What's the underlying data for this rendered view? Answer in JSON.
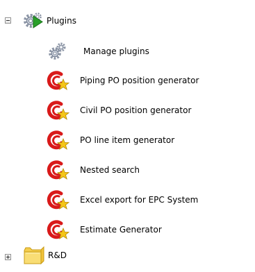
{
  "tree": {
    "root": {
      "label": "Plugins",
      "icon": "plugins-gears-play-icon",
      "expanded": true,
      "children": [
        {
          "label": "Manage plugins",
          "icon": "gears-icon"
        },
        {
          "label": "Piping PO position generator",
          "icon": "plugin-star-icon"
        },
        {
          "label": "Civil PO position generator",
          "icon": "plugin-star-icon"
        },
        {
          "label": "PO line item generator",
          "icon": "plugin-star-icon"
        },
        {
          "label": "Nested search",
          "icon": "plugin-star-icon"
        },
        {
          "label": "Excel export for EPC System",
          "icon": "plugin-star-icon"
        },
        {
          "label": "Estimate Generator",
          "icon": "plugin-star-icon"
        }
      ]
    },
    "folder": {
      "label": "R&D",
      "icon": "folder-icon",
      "expanded": false
    }
  },
  "colors": {
    "plugin_red": "#d91a1a",
    "star_yellow": "#f5c518",
    "gear_gray": "#8c95a6",
    "play_green": "#2aa02a",
    "folder_yellow": "#f7d45c"
  }
}
